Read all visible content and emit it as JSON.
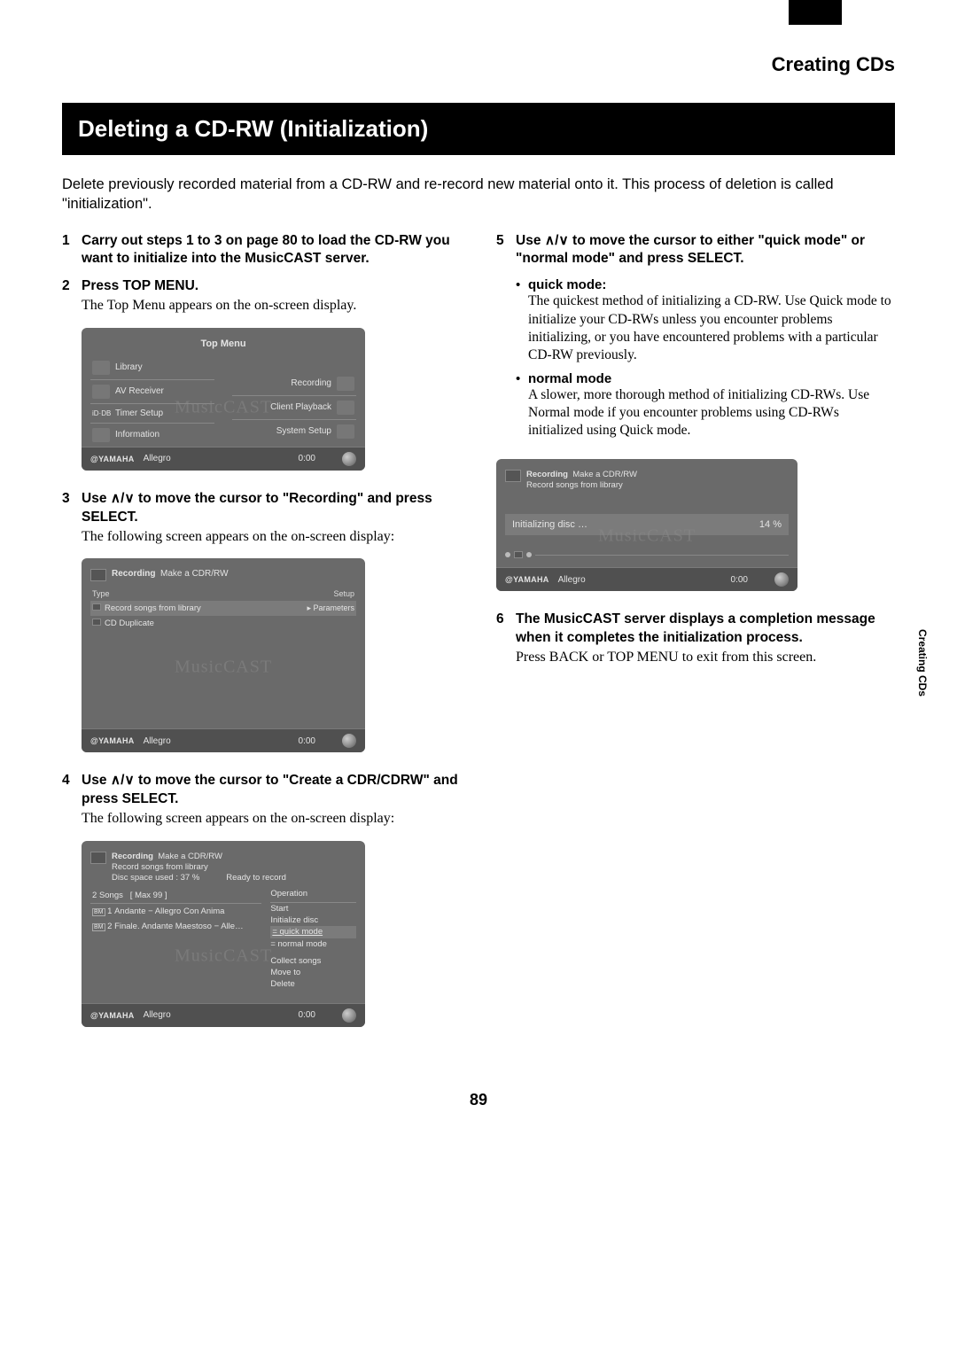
{
  "header": {
    "section_label": "Creating CDs",
    "title": "Deleting a CD-RW (Initialization)",
    "page_number": "89",
    "side_tab": "Creating CDs"
  },
  "intro": "Delete previously recorded material from a CD-RW and re-record new material onto it. This process of deletion is called \"initialization\".",
  "steps": {
    "s1": {
      "num": "1",
      "bold": "Carry out steps 1 to 3 on page 80 to load the CD-RW you want to initialize into the MusicCAST server."
    },
    "s2": {
      "num": "2",
      "bold": "Press TOP MENU.",
      "plain": "The Top Menu appears on the on-screen display."
    },
    "s3": {
      "num": "3",
      "bold_pre": "Use ",
      "bold_post": " to move the cursor to \"Recording\" and press SELECT.",
      "arrows": "∧/∨",
      "plain": "The following screen appears on the on-screen display:"
    },
    "s4": {
      "num": "4",
      "bold_pre": "Use ",
      "bold_post": " to move the cursor to \"Create a CDR/CDRW\" and press SELECT.",
      "arrows": "∧/∨",
      "plain": "The following screen appears on the on-screen display:"
    },
    "s5": {
      "num": "5",
      "bold_pre": "Use ",
      "bold_post": " to move the cursor to either \"quick mode\" or \"normal mode\" and press SELECT.",
      "arrows": "∧/∨"
    },
    "s6": {
      "num": "6",
      "bold": "The MusicCAST server displays a completion message when it completes the initialization process.",
      "plain": "Press BACK or TOP MENU to exit from this screen."
    }
  },
  "bullets": {
    "quick": {
      "label": "quick mode:",
      "text": "The quickest method of initializing a CD-RW. Use Quick mode to initialize your CD-RWs unless you encounter problems initializing, or you have encountered problems with a particular CD-RW previously."
    },
    "normal": {
      "label": "normal mode",
      "text": "A slower, more thorough method of initializing CD-RWs. Use Normal mode if you encounter problems using CD-RWs initialized using Quick mode."
    }
  },
  "shots": {
    "footer_brand": "@YAMAHA",
    "footer_track": "Allegro",
    "footer_time": "0:00",
    "watermark": "MusicCAST",
    "top_menu": {
      "title": "Top Menu",
      "left": [
        "Library",
        "AV Receiver",
        "Timer Setup",
        "Information"
      ],
      "left_prefix_timer": "iD·DB",
      "right": [
        "Recording",
        "Client Playback",
        "System Setup"
      ]
    },
    "rec1": {
      "crumb": "Recording",
      "title": "Make a CDR/RW",
      "col_l": "Type",
      "col_r": "Setup",
      "row1": "Record songs from library",
      "row1r": "Parameters",
      "row2": "CD Duplicate"
    },
    "rec2": {
      "crumb": "Recording",
      "title1": "Make a CDR/RW",
      "title2": "Record songs from library",
      "title3": "Disc space used : 37 %",
      "ready": "Ready to record",
      "songs_num": "2",
      "songs_label": "Songs",
      "max": "[ Max 99 ]",
      "op_label": "Operation",
      "row1_n": "1",
      "row1_t": "Andante − Allegro Con Anima",
      "row2_n": "2",
      "row2_t": "Finale. Andante Maestoso − Alle…",
      "ops": [
        "Start",
        "Initialize disc",
        "= quick mode",
        "= normal mode",
        "Collect songs",
        "Move to",
        "Delete"
      ],
      "bm": "BM"
    },
    "init": {
      "crumb": "Recording",
      "title1": "Make a CDR/RW",
      "title2": "Record songs from library",
      "progress_label": "Initializing disc …",
      "progress_pct": "14 %"
    }
  }
}
